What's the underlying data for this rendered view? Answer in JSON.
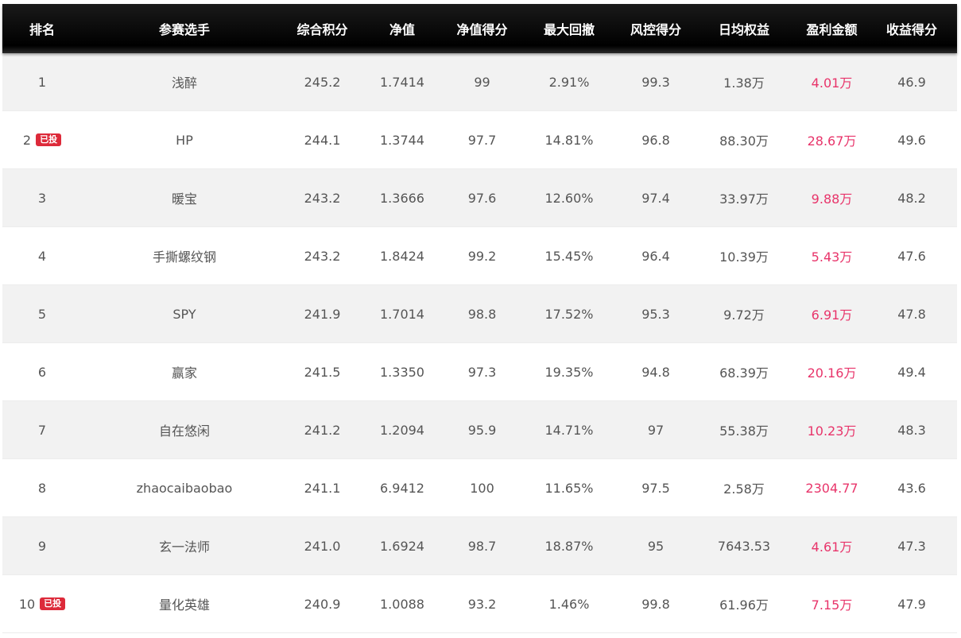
{
  "table": {
    "headers": [
      "排名",
      "参赛选手",
      "综合积分",
      "净值",
      "净值得分",
      "最大回撤",
      "风控得分",
      "日均权益",
      "盈利金额",
      "收益得分"
    ],
    "rows": [
      {
        "rank": "1",
        "badge": "",
        "player": "浅醉",
        "score": "245.2",
        "nav": "1.7414",
        "nav_score": "99",
        "max_drawdown": "2.91%",
        "risk_score": "99.3",
        "avg_equity": "1.38万",
        "profit": "4.01万",
        "return_score": "46.9"
      },
      {
        "rank": "2",
        "badge": "已投",
        "player": "HP",
        "score": "244.1",
        "nav": "1.3744",
        "nav_score": "97.7",
        "max_drawdown": "14.81%",
        "risk_score": "96.8",
        "avg_equity": "88.30万",
        "profit": "28.67万",
        "return_score": "49.6"
      },
      {
        "rank": "3",
        "badge": "",
        "player": "暖宝",
        "score": "243.2",
        "nav": "1.3666",
        "nav_score": "97.6",
        "max_drawdown": "12.60%",
        "risk_score": "97.4",
        "avg_equity": "33.97万",
        "profit": "9.88万",
        "return_score": "48.2"
      },
      {
        "rank": "4",
        "badge": "",
        "player": "手撕螺纹钢",
        "score": "243.2",
        "nav": "1.8424",
        "nav_score": "99.2",
        "max_drawdown": "15.45%",
        "risk_score": "96.4",
        "avg_equity": "10.39万",
        "profit": "5.43万",
        "return_score": "47.6"
      },
      {
        "rank": "5",
        "badge": "",
        "player": "SPY",
        "score": "241.9",
        "nav": "1.7014",
        "nav_score": "98.8",
        "max_drawdown": "17.52%",
        "risk_score": "95.3",
        "avg_equity": "9.72万",
        "profit": "6.91万",
        "return_score": "47.8"
      },
      {
        "rank": "6",
        "badge": "",
        "player": "赢家",
        "score": "241.5",
        "nav": "1.3350",
        "nav_score": "97.3",
        "max_drawdown": "19.35%",
        "risk_score": "94.8",
        "avg_equity": "68.39万",
        "profit": "20.16万",
        "return_score": "49.4"
      },
      {
        "rank": "7",
        "badge": "",
        "player": "自在悠闲",
        "score": "241.2",
        "nav": "1.2094",
        "nav_score": "95.9",
        "max_drawdown": "14.71%",
        "risk_score": "97",
        "avg_equity": "55.38万",
        "profit": "10.23万",
        "return_score": "48.3"
      },
      {
        "rank": "8",
        "badge": "",
        "player": "zhaocaibaobao",
        "score": "241.1",
        "nav": "6.9412",
        "nav_score": "100",
        "max_drawdown": "11.65%",
        "risk_score": "97.5",
        "avg_equity": "2.58万",
        "profit": "2304.77",
        "return_score": "43.6"
      },
      {
        "rank": "9",
        "badge": "",
        "player": "玄一法师",
        "score": "241.0",
        "nav": "1.6924",
        "nav_score": "98.7",
        "max_drawdown": "18.87%",
        "risk_score": "95",
        "avg_equity": "7643.53",
        "profit": "4.61万",
        "return_score": "47.3"
      },
      {
        "rank": "10",
        "badge": "已投",
        "player": "量化英雄",
        "score": "240.9",
        "nav": "1.0088",
        "nav_score": "93.2",
        "max_drawdown": "1.46%",
        "risk_score": "99.8",
        "avg_equity": "61.96万",
        "profit": "7.15万",
        "return_score": "47.9"
      }
    ]
  },
  "colors": {
    "header_bg": "#000000",
    "header_text": "#ffffff",
    "odd_row_bg": "#f2f2f2",
    "even_row_bg": "#ffffff",
    "text": "#555555",
    "profit_text": "#e8346a",
    "badge_bg": "#dd2a3a"
  }
}
